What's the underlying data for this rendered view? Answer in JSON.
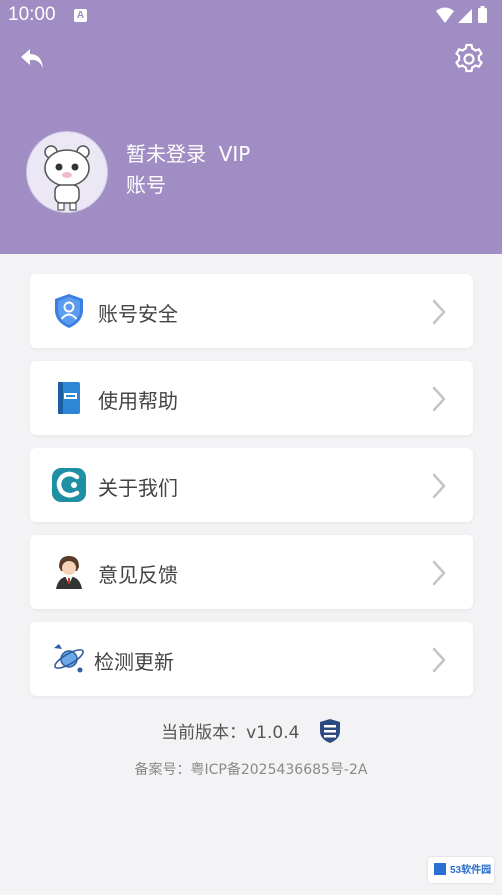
{
  "status_bar": {
    "time": "10:00",
    "notification_badge": "A"
  },
  "header": {
    "background": "#9f8dc4",
    "user_name": "暂未登录  VIP",
    "account_label": "账号"
  },
  "menu": [
    {
      "label": "账号安全",
      "icon": "shield-user-icon"
    },
    {
      "label": "使用帮助",
      "icon": "help-book-icon"
    },
    {
      "label": "关于我们",
      "icon": "about-logo-icon"
    },
    {
      "label": "意见反馈",
      "icon": "feedback-person-icon"
    },
    {
      "label": "检测更新",
      "icon": "update-satellite-icon"
    }
  ],
  "footer": {
    "version": "当前版本：v1.0.4",
    "icp": "备案号：粤ICP备2025436685号-2A"
  },
  "watermark": {
    "text": "53软件园"
  }
}
